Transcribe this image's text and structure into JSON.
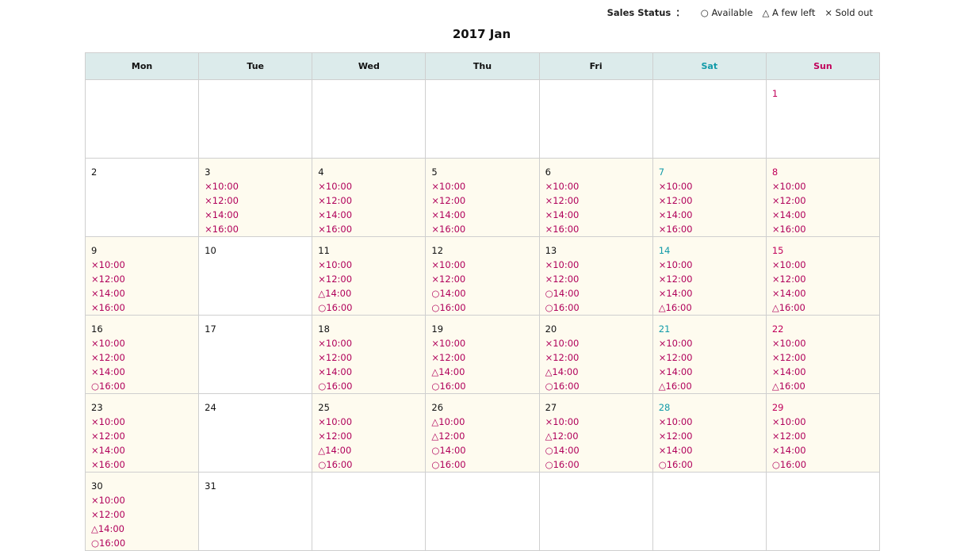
{
  "legend": {
    "label": "Sales Status",
    "separator": "：",
    "available": "○ Available",
    "few": "△ A few left",
    "soldout": "× Sold out"
  },
  "calendar": {
    "title": "2017 Jan",
    "weekdays": [
      "Mon",
      "Tue",
      "Wed",
      "Thu",
      "Fri",
      "Sat",
      "Sun"
    ],
    "weeks": [
      [
        {
          "day": "",
          "slots": []
        },
        {
          "day": "",
          "slots": []
        },
        {
          "day": "",
          "slots": []
        },
        {
          "day": "",
          "slots": []
        },
        {
          "day": "",
          "slots": []
        },
        {
          "day": "",
          "slots": []
        },
        {
          "day": "1",
          "slots": []
        }
      ],
      [
        {
          "day": "2",
          "slots": []
        },
        {
          "day": "3",
          "slots": [
            "×10:00",
            "×12:00",
            "×14:00",
            "×16:00"
          ]
        },
        {
          "day": "4",
          "slots": [
            "×10:00",
            "×12:00",
            "×14:00",
            "×16:00"
          ]
        },
        {
          "day": "5",
          "slots": [
            "×10:00",
            "×12:00",
            "×14:00",
            "×16:00"
          ]
        },
        {
          "day": "6",
          "slots": [
            "×10:00",
            "×12:00",
            "×14:00",
            "×16:00"
          ]
        },
        {
          "day": "7",
          "slots": [
            "×10:00",
            "×12:00",
            "×14:00",
            "×16:00"
          ]
        },
        {
          "day": "8",
          "slots": [
            "×10:00",
            "×12:00",
            "×14:00",
            "×16:00"
          ]
        }
      ],
      [
        {
          "day": "9",
          "slots": [
            "×10:00",
            "×12:00",
            "×14:00",
            "×16:00"
          ]
        },
        {
          "day": "10",
          "slots": []
        },
        {
          "day": "11",
          "slots": [
            "×10:00",
            "×12:00",
            "△14:00",
            "○16:00"
          ]
        },
        {
          "day": "12",
          "slots": [
            "×10:00",
            "×12:00",
            "○14:00",
            "○16:00"
          ]
        },
        {
          "day": "13",
          "slots": [
            "×10:00",
            "×12:00",
            "○14:00",
            "○16:00"
          ]
        },
        {
          "day": "14",
          "slots": [
            "×10:00",
            "×12:00",
            "×14:00",
            "△16:00"
          ]
        },
        {
          "day": "15",
          "slots": [
            "×10:00",
            "×12:00",
            "×14:00",
            "△16:00"
          ]
        }
      ],
      [
        {
          "day": "16",
          "slots": [
            "×10:00",
            "×12:00",
            "×14:00",
            "○16:00"
          ]
        },
        {
          "day": "17",
          "slots": []
        },
        {
          "day": "18",
          "slots": [
            "×10:00",
            "×12:00",
            "×14:00",
            "○16:00"
          ]
        },
        {
          "day": "19",
          "slots": [
            "×10:00",
            "×12:00",
            "△14:00",
            "○16:00"
          ]
        },
        {
          "day": "20",
          "slots": [
            "×10:00",
            "×12:00",
            "△14:00",
            "○16:00"
          ]
        },
        {
          "day": "21",
          "slots": [
            "×10:00",
            "×12:00",
            "×14:00",
            "△16:00"
          ]
        },
        {
          "day": "22",
          "slots": [
            "×10:00",
            "×12:00",
            "×14:00",
            "△16:00"
          ]
        }
      ],
      [
        {
          "day": "23",
          "slots": [
            "×10:00",
            "×12:00",
            "×14:00",
            "×16:00"
          ]
        },
        {
          "day": "24",
          "slots": []
        },
        {
          "day": "25",
          "slots": [
            "×10:00",
            "×12:00",
            "△14:00",
            "○16:00"
          ]
        },
        {
          "day": "26",
          "slots": [
            "△10:00",
            "△12:00",
            "○14:00",
            "○16:00"
          ]
        },
        {
          "day": "27",
          "slots": [
            "×10:00",
            "△12:00",
            "○14:00",
            "○16:00"
          ]
        },
        {
          "day": "28",
          "slots": [
            "×10:00",
            "×12:00",
            "×14:00",
            "○16:00"
          ]
        },
        {
          "day": "29",
          "slots": [
            "×10:00",
            "×12:00",
            "×14:00",
            "○16:00"
          ]
        }
      ],
      [
        {
          "day": "30",
          "slots": [
            "×10:00",
            "×12:00",
            "△14:00",
            "○16:00"
          ]
        },
        {
          "day": "31",
          "slots": []
        },
        {
          "day": "",
          "slots": []
        },
        {
          "day": "",
          "slots": []
        },
        {
          "day": "",
          "slots": []
        },
        {
          "day": "",
          "slots": []
        },
        {
          "day": "",
          "slots": []
        }
      ]
    ]
  },
  "colors": {
    "header_bg": "#dcebeb",
    "open_day_bg": "#fefbef",
    "saturday": "#119aa8",
    "sunday": "#c1005a",
    "slot_text": "#b0005a"
  }
}
